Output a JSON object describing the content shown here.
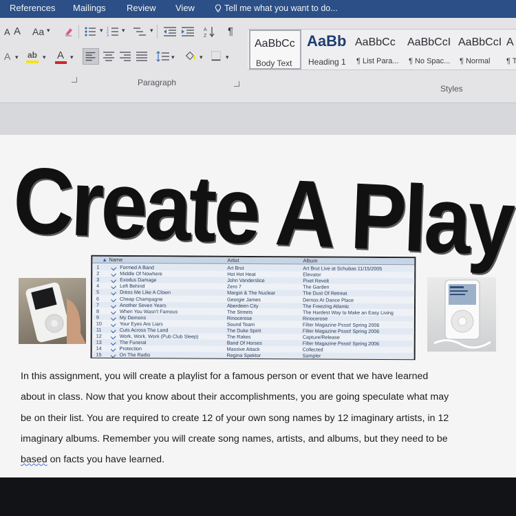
{
  "ribbon_tabs": [
    "References",
    "Mailings",
    "Review",
    "View"
  ],
  "tell_me": {
    "placeholder": "Tell me what you want to do..."
  },
  "font_group": {
    "grow_font": "A",
    "shrink_font": "A",
    "change_case": "Aa",
    "text_effects": "A",
    "highlight": "ab",
    "font_color": "A"
  },
  "paragraph_group": {
    "label": "Paragraph",
    "pilcrow": "¶"
  },
  "styles_group": {
    "label": "Styles",
    "items": [
      {
        "sample": "AaBbCc",
        "name": "Body Text"
      },
      {
        "sample": "AaBb",
        "name": "Heading 1"
      },
      {
        "sample": "AaBbCc",
        "name": "¶ List Para..."
      },
      {
        "sample": "AaBbCcI",
        "name": "¶ No Spac..."
      },
      {
        "sample": "AaBbCcI",
        "name": "¶ Normal"
      },
      {
        "sample": "A",
        "name": "¶ T"
      }
    ]
  },
  "document": {
    "title": "Create A Playlist",
    "playlist": {
      "headers": [
        "Name",
        "Artist",
        "Album"
      ],
      "rows": [
        {
          "n": "1",
          "name": "Formed A Band",
          "artist": "Art Brut",
          "album": "Art Brut Live at Schubas 11/15/2005"
        },
        {
          "n": "2",
          "name": "Middle Of Nowhere",
          "artist": "Hot Hot Heat",
          "album": "Elevator"
        },
        {
          "n": "3",
          "name": "Exodus Damage",
          "artist": "John Vanderslice",
          "album": "Pixel Revolt"
        },
        {
          "n": "4",
          "name": "Left Behind",
          "artist": "Zero 7",
          "album": "The Garden"
        },
        {
          "n": "5",
          "name": "Dress Me Like A Clown",
          "artist": "Margot & The Nuclear",
          "album": "The Dust Of Retreat"
        },
        {
          "n": "6",
          "name": "Cheap Champagne",
          "artist": "Georgie James",
          "album": "Demos At Dance Place"
        },
        {
          "n": "7",
          "name": "Another Seven Years",
          "artist": "Aberdeen City",
          "album": "The Freezing Atlantic"
        },
        {
          "n": "8",
          "name": "When You Wasn't Famous",
          "artist": "The Streets",
          "album": "The Hardest Way to Make an Easy Living"
        },
        {
          "n": "9",
          "name": "My Demons",
          "artist": "Rinocerose",
          "album": "Rinocerose"
        },
        {
          "n": "10",
          "name": "Your Eyes Are Liars",
          "artist": "Sound Team",
          "album": "Filter Magazine Pssst! Spring 2006"
        },
        {
          "n": "11",
          "name": "Cuts Across The Land",
          "artist": "The Duke Spirit",
          "album": "Filter Magazine Pssst! Spring 2006"
        },
        {
          "n": "12",
          "name": "Work, Work, Work (Pub Club Sleep)",
          "artist": "The Rakes",
          "album": "Capture/Release"
        },
        {
          "n": "13",
          "name": "The Funeral",
          "artist": "Band Of Horses",
          "album": "Filter Magazine Pssst! Spring 2006"
        },
        {
          "n": "14",
          "name": "Protection",
          "artist": "Massive Attack",
          "album": "Collected"
        },
        {
          "n": "15",
          "name": "On The Radio",
          "artist": "Regina Spektor",
          "album": "Sampler"
        }
      ]
    },
    "body_lines": [
      "In this assignment, you will create a playlist for a famous person or event that we have learned",
      "about in class. Now that you know about their accomplishments, you are going speculate what may",
      "be on their list. You are required to create 12 of your own song names by 12 imaginary artists, in 12",
      "imaginary albums. Remember you will create song names, artists, and albums, but they need to be"
    ],
    "last_line_flagged": "based",
    "last_line_rest": " on facts you have learned."
  },
  "colors": {
    "ribbon_tab_bar": "#2b4f86",
    "ribbon_body": "#e4e4e6",
    "page": "#f5f5f6",
    "font_color_red": "#d0262c",
    "highlight_yellow": "#f3e21d"
  }
}
